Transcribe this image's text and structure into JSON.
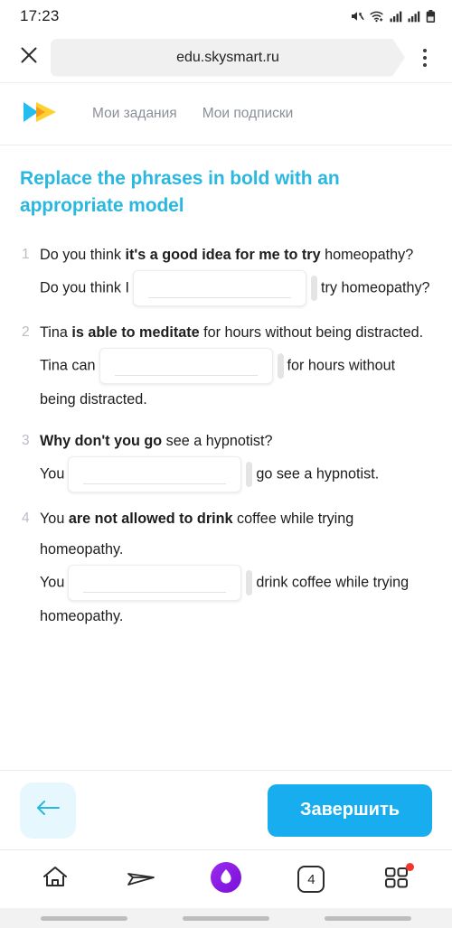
{
  "status_bar": {
    "time": "17:23",
    "icons": [
      "mute-icon",
      "wifi-icon",
      "signal-icon",
      "signal-icon",
      "battery-icon"
    ]
  },
  "browser": {
    "close_label": "close-icon",
    "url": "edu.skysmart.ru",
    "menu_label": "overflow-menu-icon"
  },
  "site_header": {
    "logo": "skysmart-logo",
    "nav": [
      {
        "label": "Мои задания"
      },
      {
        "label": "Мои подписки"
      }
    ]
  },
  "task": {
    "title": "Replace the phrases in bold with an appropriate model",
    "questions": [
      {
        "number": "1",
        "prompt_before": "Do you think ",
        "prompt_bold": "it's a good idea for me to try",
        "prompt_after": " homeopathy?",
        "answer_before": "Do you think I",
        "answer_after": "try homeopathy?",
        "input_value": "",
        "input_width": 192
      },
      {
        "number": "2",
        "prompt_before": "Tina ",
        "prompt_bold": "is able to meditate",
        "prompt_after": " for hours without being distracted.",
        "answer_before": "Tina can",
        "answer_after": "for hours without being distracted.",
        "input_value": "",
        "input_width": 192
      },
      {
        "number": "3",
        "prompt_before": "",
        "prompt_bold": "Why don't you go",
        "prompt_after": " see a hypnotist?",
        "answer_before": "You",
        "answer_after": "go see a hypnotist.",
        "input_value": "",
        "input_width": 192
      },
      {
        "number": "4",
        "prompt_before": "You ",
        "prompt_bold": "are not allowed to drink",
        "prompt_after": " coffee while trying homeopathy.",
        "answer_before": "You",
        "answer_after": "drink coffee while trying homeopathy.",
        "input_value": "",
        "input_width": 192
      }
    ]
  },
  "footer": {
    "back_label": "back-arrow-icon",
    "finish_label": "Завершить"
  },
  "bottom_nav": {
    "items": [
      {
        "name": "home-icon"
      },
      {
        "name": "share-icon"
      },
      {
        "name": "alice-assistant-icon"
      },
      {
        "name": "tabs-icon",
        "count": "4"
      },
      {
        "name": "apps-grid-icon",
        "badge": true
      }
    ]
  },
  "colors": {
    "accent_title": "#2ab7e0",
    "primary_button": "#18adef",
    "back_button_bg": "#e6f7fd",
    "badge": "#f4362f",
    "alice_purple": "#8d1fe0"
  }
}
